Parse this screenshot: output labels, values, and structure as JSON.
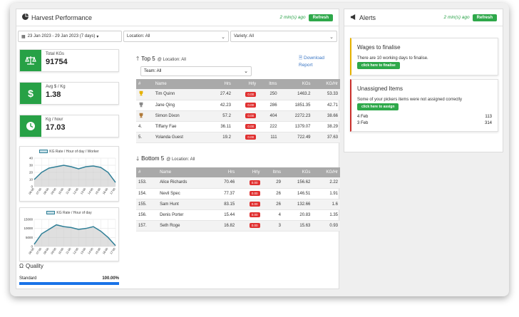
{
  "main": {
    "title": "Harvest Performance",
    "updated": "2 min(s) ago",
    "refresh_label": "Refresh"
  },
  "filters": {
    "date_range": "23 Jan 2023 - 29 Jan 2023 (7 days)",
    "location": "Location: All",
    "variety": "Variety: All"
  },
  "kpis": [
    {
      "label": "Total KGs",
      "value": "91754",
      "icon": "scale-icon"
    },
    {
      "label": "Avg $ / Kg",
      "value": "1.38",
      "icon": "dollar-icon"
    },
    {
      "label": "Kg / hour",
      "value": "17.03",
      "icon": "clock-icon"
    }
  ],
  "chart_data": [
    {
      "type": "area",
      "legend": "KG Rate / Hour of day / Worker",
      "categories": [
        "06:00",
        "07:00",
        "08:00",
        "09:00",
        "10:00",
        "11:00",
        "12:00",
        "13:00",
        "14:00",
        "15:00",
        "16:00",
        "17:00"
      ],
      "values": [
        10,
        20,
        26,
        28,
        30,
        28,
        25,
        28,
        29,
        27,
        20,
        6
      ],
      "ylim": [
        0,
        40
      ],
      "yticks": [
        0,
        10,
        20,
        30,
        40
      ],
      "grid": true,
      "color": "#2f7f97"
    },
    {
      "type": "area",
      "legend": "KG Rate / Hour of day",
      "categories": [
        "06:00",
        "07:00",
        "08:00",
        "09:00",
        "10:00",
        "11:00",
        "12:00",
        "13:00",
        "14:00",
        "15:00",
        "16:00",
        "17:00"
      ],
      "values": [
        1200,
        7000,
        9500,
        12000,
        11000,
        10500,
        9500,
        10000,
        11000,
        8500,
        5000,
        500
      ],
      "ylim": [
        0,
        15000
      ],
      "yticks": [
        0,
        5000,
        10000,
        15000
      ],
      "grid": true,
      "color": "#2f7f97"
    }
  ],
  "quality": {
    "title": "Quality",
    "label": "Standard",
    "value": "100.00%",
    "fill": 1.0
  },
  "top5": {
    "title": "Top 5",
    "location": "@ Location: All",
    "download": "Download Report",
    "team": "Team: All",
    "headers": [
      "#",
      "Name",
      "Hrs",
      "Hrly",
      "Itms",
      "KGs",
      "KG/Hr"
    ],
    "rows": [
      {
        "rank": "trophy-gold",
        "name": "Tim Quinn",
        "hrs": "27.42",
        "hrly": "0.00",
        "itms": "250",
        "kgs": "1463.2",
        "kghr": "53.33"
      },
      {
        "rank": "trophy-silver",
        "name": "Jane Qing",
        "hrs": "42.23",
        "hrly": "0.00",
        "itms": "286",
        "kgs": "1851.35",
        "kghr": "42.71"
      },
      {
        "rank": "trophy-bronze",
        "name": "Simon Dixon",
        "hrs": "57.2",
        "hrly": "0.00",
        "itms": "404",
        "kgs": "2272.23",
        "kghr": "38.66"
      },
      {
        "rank": "4.",
        "name": "Tiffany Fae",
        "hrs": "36.11",
        "hrly": "0.00",
        "itms": "222",
        "kgs": "1379.07",
        "kghr": "38.29"
      },
      {
        "rank": "5.",
        "name": "Yolanda Guest",
        "hrs": "19.2",
        "hrly": "0.00",
        "itms": "111",
        "kgs": "722.49",
        "kghr": "37.63"
      }
    ]
  },
  "bottom5": {
    "title": "Bottom 5",
    "location": "@ Location: All",
    "headers": [
      "#",
      "Name",
      "Hrs",
      "Hrly",
      "Itms",
      "KGs",
      "KG/Hr"
    ],
    "rows": [
      {
        "rank": "153.",
        "name": "Alice Richards",
        "hrs": "70.46",
        "hrly": "0.00",
        "itms": "29",
        "kgs": "156.62",
        "kghr": "2.22"
      },
      {
        "rank": "154.",
        "name": "Nevil Spec",
        "hrs": "77.37",
        "hrly": "0.00",
        "itms": "26",
        "kgs": "146.51",
        "kghr": "1.91"
      },
      {
        "rank": "155.",
        "name": "Sam Hunt",
        "hrs": "83.15",
        "hrly": "0.00",
        "itms": "26",
        "kgs": "132.66",
        "kghr": "1.6"
      },
      {
        "rank": "156.",
        "name": "Denis Porter",
        "hrs": "15.44",
        "hrly": "0.00",
        "itms": "4",
        "kgs": "20.83",
        "kghr": "1.35"
      },
      {
        "rank": "157.",
        "name": "Seth Roge",
        "hrs": "16.82",
        "hrly": "0.00",
        "itms": "3",
        "kgs": "15.63",
        "kghr": "0.93"
      }
    ]
  },
  "alerts": {
    "title": "Alerts",
    "updated": "2 min(s) ago",
    "refresh_label": "Refresh",
    "wages": {
      "title": "Wages to finalise",
      "text": "There are 10 working days to finalise.",
      "button": "click here to finalise"
    },
    "unassigned": {
      "title": "Unassigned Items",
      "text": "Some of your pickers items were not assigned correctly",
      "button": "click here to assign",
      "rows": [
        {
          "date": "4 Feb",
          "count": "113"
        },
        {
          "date": "3 Feb",
          "count": "314"
        }
      ]
    }
  }
}
